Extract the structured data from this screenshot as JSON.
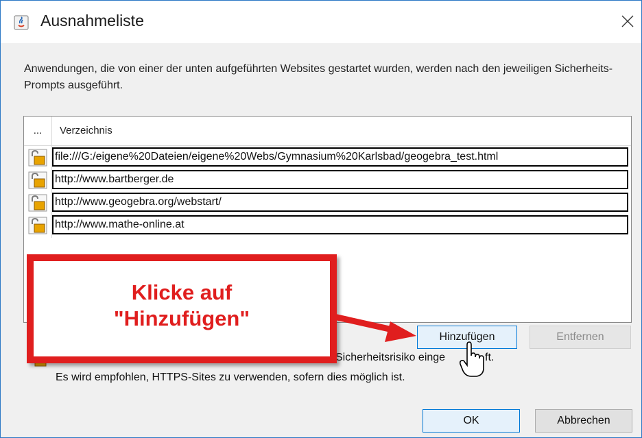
{
  "window": {
    "title": "Ausnahmeliste"
  },
  "description": "Anwendungen, die von einer der unten aufgeführten Websites gestartet wurden, werden nach den jeweiligen Sicherheits-Prompts ausgeführt.",
  "table": {
    "header_dots": "...",
    "header_dir": "Verzeichnis",
    "rows": [
      "file:///G:/eigene%20Dateien/eigene%20Webs/Gymnasium%20Karlsbad/geogebra_test.html",
      "http://www.bartberger.de",
      "http://www.geogebra.org/webstart/",
      "http://www.mathe-online.at"
    ]
  },
  "buttons": {
    "add": "Hinzufügen",
    "remove": "Entfernen",
    "ok": "OK",
    "cancel": "Abbrechen"
  },
  "warning": {
    "line1_visible": "Sicherheitsrisiko einge",
    "line1_tail": "ft.",
    "line2": "Es wird empfohlen, HTTPS-Sites zu verwenden, sofern dies möglich ist."
  },
  "callout": {
    "text": "Klicke auf\n\"Hinzufügen\""
  },
  "icons": {
    "title": "java-icon",
    "close": "close-icon",
    "row": "lock-icon",
    "warning": "lock-icon",
    "cursor": "hand-cursor-icon"
  },
  "colors": {
    "accent": "#0078d7",
    "callout": "#e01e1e",
    "lock": "#e8a300"
  }
}
